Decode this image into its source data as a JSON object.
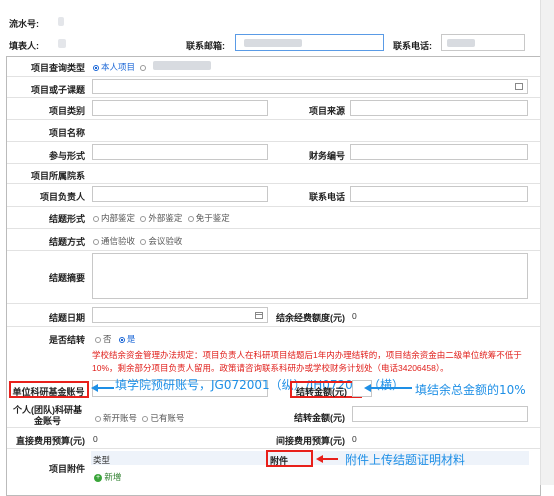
{
  "header": {
    "serial_label": "流水号:",
    "filler_label": "填表人:",
    "email_label": "联系邮箱:",
    "phone_label": "联系电话:"
  },
  "form": {
    "query_type_label": "项目查询类型",
    "query_type_options": [
      "本人项目"
    ],
    "subproject_label": "项目或子课题",
    "project_category_label": "项目类别",
    "project_source_label": "项目来源",
    "project_name_label": "项目名称",
    "participation_label": "参与形式",
    "finance_no_label": "财务编号",
    "department_label": "项目所属院系",
    "leader_label": "项目负责人",
    "contact_phone_label": "联系电话",
    "conclusion_form_label": "结题形式",
    "conclusion_form_options": [
      "内部鉴定",
      "外部鉴定",
      "免于鉴定"
    ],
    "conclusion_method_label": "结题方式",
    "conclusion_method_options": [
      "通信验收",
      "会议验收"
    ],
    "summary_label": "结题摘要",
    "end_date_label": "结题日期",
    "balance_label": "结余经费额度(元)",
    "balance_value": "0",
    "carryover_label": "是否结转",
    "carryover_no": "否",
    "carryover_yes": "是",
    "policy_note": "学校结余资金管理办法规定：项目负责人在科研项目结题后1年内办理结转的，项目结余资金由二级单位统筹不低于10%，剩余部分项目负责人留用。政策请咨询联系科研办或学校财务计划处（电话34206458）。",
    "unit_account_label": "单位科研基金账号",
    "transfer_amount_label": "结转金额(元)",
    "personal_account_label": "个人(团队)科研基金账号",
    "personal_account_options": [
      "新开账号",
      "已有账号"
    ],
    "transfer_amount2_label": "结转金额(元)",
    "direct_budget_label": "直接费用预算(元)",
    "direct_budget_value": "0",
    "indirect_budget_label": "间接费用预算(元)",
    "indirect_budget_value": "0",
    "attachment_label": "项目附件",
    "attach_type_header": "类型",
    "attach_header": "附件",
    "add_label": "新增"
  },
  "annotations": {
    "account_hint": "填学院预研账号，JG072001（纵）/JH072001（横）",
    "amount_hint": "填结余总金额的10%",
    "attachment_hint": "附件上传结题证明材料"
  },
  "colors": {
    "annotation_blue": "#1e8fe6",
    "highlight_red": "#e8201b",
    "note_red": "#e0201c",
    "radio_blue": "#1a66d6"
  }
}
